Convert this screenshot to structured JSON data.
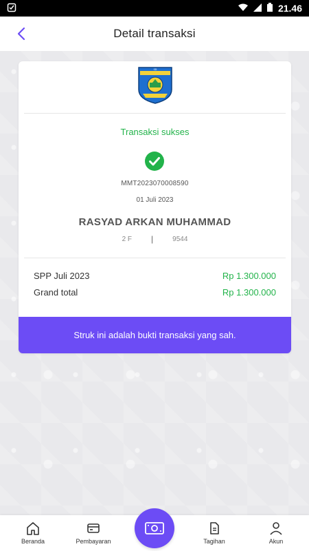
{
  "status_bar": {
    "time": "21.46"
  },
  "header": {
    "title": "Detail transaksi"
  },
  "receipt": {
    "status": "Transaksi sukses",
    "transaction_id": "MMT2023070008590",
    "date": "01 Juli 2023",
    "student_name": "RASYAD ARKAN MUHAMMAD",
    "student_class": "2 F",
    "student_id": "9544",
    "items": [
      {
        "label": "SPP Juli 2023",
        "amount": "Rp 1.300.000"
      },
      {
        "label": "Grand total",
        "amount": "Rp 1.300.000"
      }
    ],
    "footer_note": "Struk ini adalah bukti transaksi yang sah."
  },
  "bottom_nav": {
    "items": [
      {
        "label": "Beranda",
        "icon": "home-icon"
      },
      {
        "label": "Pembayaran",
        "icon": "card-icon"
      },
      {
        "label": "",
        "icon": "money-icon"
      },
      {
        "label": "Tagihan",
        "icon": "bill-icon"
      },
      {
        "label": "Akun",
        "icon": "user-icon"
      }
    ]
  },
  "colors": {
    "accent": "#6c4cf5",
    "success": "#22b34a",
    "background": "#e9e9ec"
  }
}
